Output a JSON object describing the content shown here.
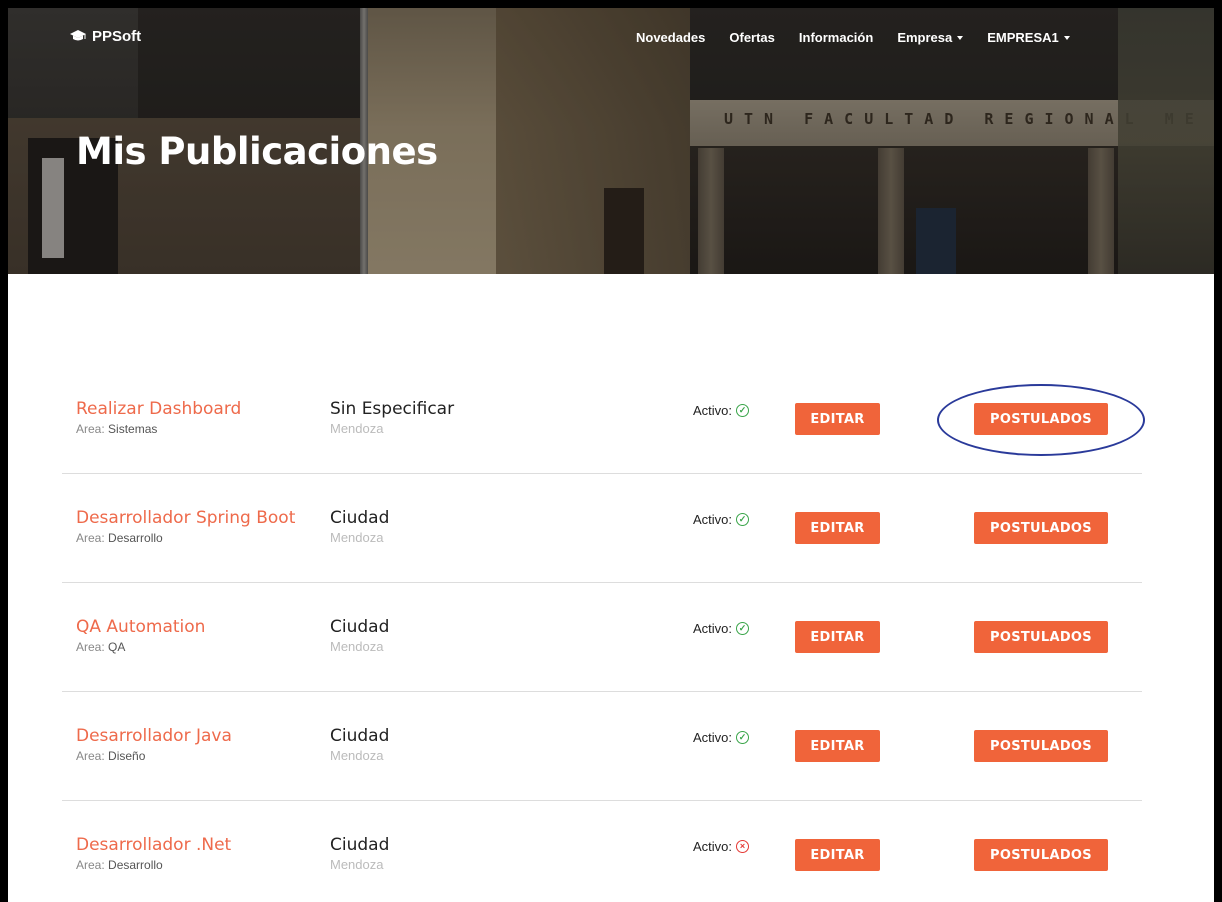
{
  "brand": {
    "name": "PPSoft",
    "icon": "graduation-cap-icon"
  },
  "nav": {
    "items": [
      {
        "label": "Novedades",
        "dropdown": false
      },
      {
        "label": "Ofertas",
        "dropdown": false
      },
      {
        "label": "Información",
        "dropdown": false
      },
      {
        "label": "Empresa",
        "dropdown": true
      },
      {
        "label": "EMPRESA1",
        "dropdown": true
      }
    ]
  },
  "hero": {
    "title": "Mis Publicaciones",
    "sign_text": "UTN FACULTAD REGIONAL ME"
  },
  "labels": {
    "area_prefix": "Area:",
    "status_prefix": "Activo:",
    "edit_button": "EDITAR",
    "applicants_button": "POSTULADOS"
  },
  "publications": [
    {
      "title": "Realizar Dashboard",
      "area": "Sistemas",
      "location_type": "Sin Especificar",
      "city": "Mendoza",
      "active": true,
      "highlighted": true
    },
    {
      "title": "Desarrollador Spring Boot",
      "area": "Desarrollo",
      "location_type": "Ciudad",
      "city": "Mendoza",
      "active": true,
      "highlighted": false
    },
    {
      "title": "QA Automation",
      "area": "QA",
      "location_type": "Ciudad",
      "city": "Mendoza",
      "active": true,
      "highlighted": false
    },
    {
      "title": "Desarrollador Java",
      "area": "Diseño",
      "location_type": "Ciudad",
      "city": "Mendoza",
      "active": true,
      "highlighted": false
    },
    {
      "title": "Desarrollador .Net",
      "area": "Desarrollo",
      "location_type": "Ciudad",
      "city": "Mendoza",
      "active": false,
      "highlighted": false
    }
  ],
  "colors": {
    "accent": "#f0643a",
    "title_link": "#ee6a4b",
    "active_ok": "#3aa54a",
    "inactive": "#e53935",
    "highlight_ring": "#2a3a9a"
  }
}
